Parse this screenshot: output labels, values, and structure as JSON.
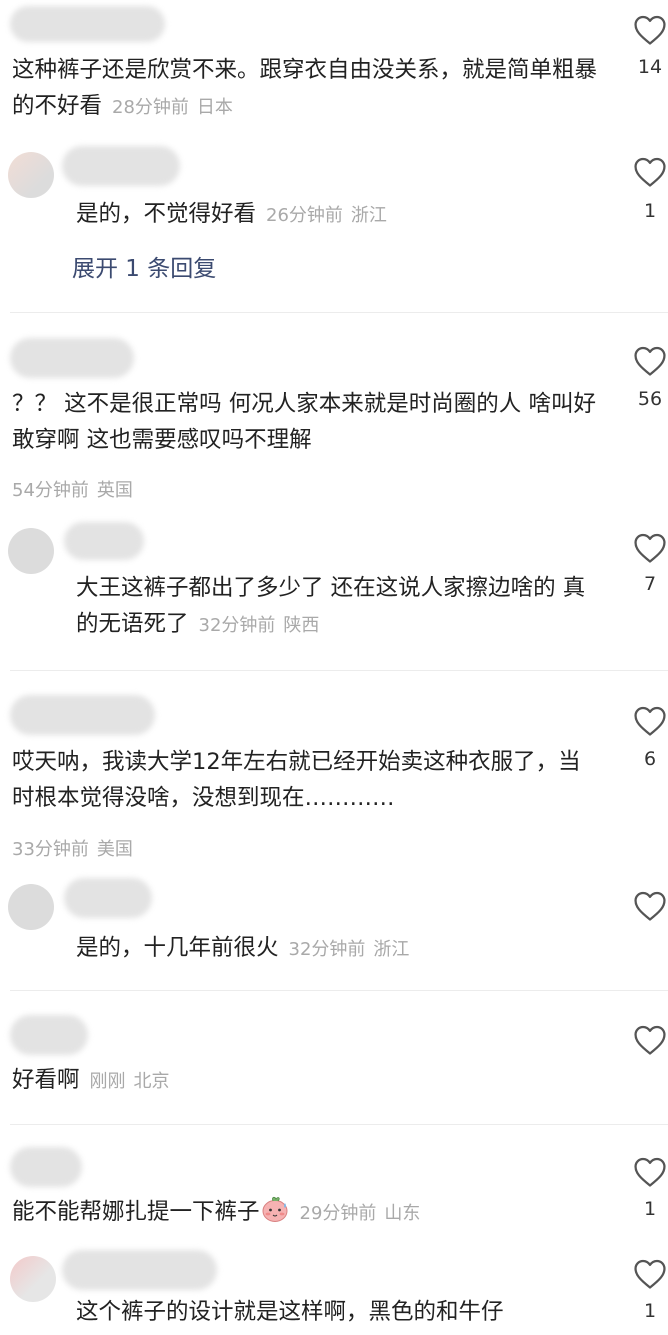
{
  "comments": [
    {
      "text": "这种裤子还是欣赏不来。跟穿衣自由没关系，就是简单粗暴的不好看",
      "time": "28分钟前",
      "location": "日本",
      "likes": "14",
      "reply": {
        "text": "是的，不觉得好看",
        "time": "26分钟前",
        "location": "浙江",
        "likes": "1"
      },
      "expand_label": "展开 1 条回复"
    },
    {
      "text": "？？ 这不是很正常吗 何况人家本来就是时尚圈的人 啥叫好敢穿啊 这也需要感叹吗不理解",
      "time": "54分钟前",
      "location": "英国",
      "likes": "56",
      "reply": {
        "text": "大王这裤子都出了多少了 还在这说人家擦边啥的 真的无语死了",
        "time": "32分钟前",
        "location": "陕西",
        "likes": "7"
      }
    },
    {
      "text": "哎天呐，我读大学12年左右就已经开始卖这种衣服了，当时根本觉得没啥，没想到现在…………",
      "time": "33分钟前",
      "location": "美国",
      "likes": "6",
      "reply": {
        "text": "是的，十几年前很火",
        "time": "32分钟前",
        "location": "浙江",
        "likes": ""
      }
    },
    {
      "text": "好看啊",
      "time": "刚刚",
      "location": "北京",
      "likes": ""
    },
    {
      "text": "能不能帮娜扎提一下裤子",
      "time": "29分钟前",
      "location": "山东",
      "likes": "1",
      "emoji": "blushing-peach-emoji",
      "reply": {
        "text": "这个裤子的设计就是这样啊，黑色的和牛仔",
        "likes": "1"
      }
    }
  ]
}
